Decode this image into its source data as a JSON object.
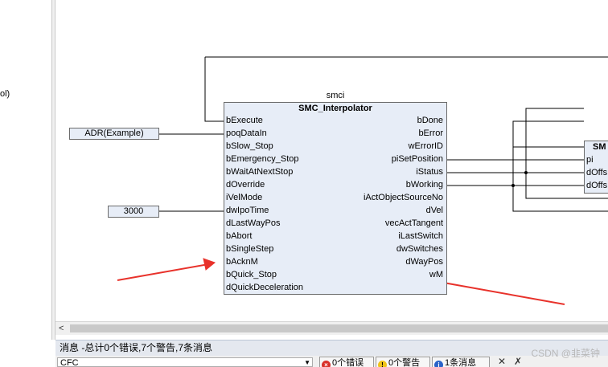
{
  "left_pane": {
    "fragment": "ol)"
  },
  "fb": {
    "instance": "smci",
    "type": "SMC_Interpolator",
    "inputs": [
      "bExecute",
      "poqDataIn",
      "bSlow_Stop",
      "bEmergency_Stop",
      "bWaitAtNextStop",
      "dOverride",
      "iVelMode",
      "dwIpoTime",
      "dLastWayPos",
      "bAbort",
      "bSingleStep",
      "bAcknM",
      "bQuick_Stop",
      "dQuickDeceleration"
    ],
    "outputs": [
      "bDone",
      "bError",
      "wErrorID",
      "piSetPosition",
      "iStatus",
      "bWorking",
      "iActObjectSourceNo",
      "dVel",
      "vecActTangent",
      "iLastSwitch",
      "dwSwitches",
      "dWayPos",
      "wM"
    ]
  },
  "constants": {
    "adr": "ADR(Example)",
    "ipo": "3000"
  },
  "fb2": {
    "title": "SM",
    "pins": [
      "pi",
      "dOffs",
      "dOffs"
    ]
  },
  "hscroll": {
    "left_arrow": "<"
  },
  "message_bar": {
    "text": "消息 -总计0个错误,7个警告,7条消息"
  },
  "bottom": {
    "combo_value": "CFC",
    "btn_errors": "0个错误",
    "btn_warnings": "0个警告",
    "btn_messages": "1条消息"
  },
  "watermark": "CSDN @韭菜钟",
  "colors": {
    "arrow": "#e8322b",
    "block_fill": "#e7edf7",
    "block_border": "#6b6b6b"
  }
}
